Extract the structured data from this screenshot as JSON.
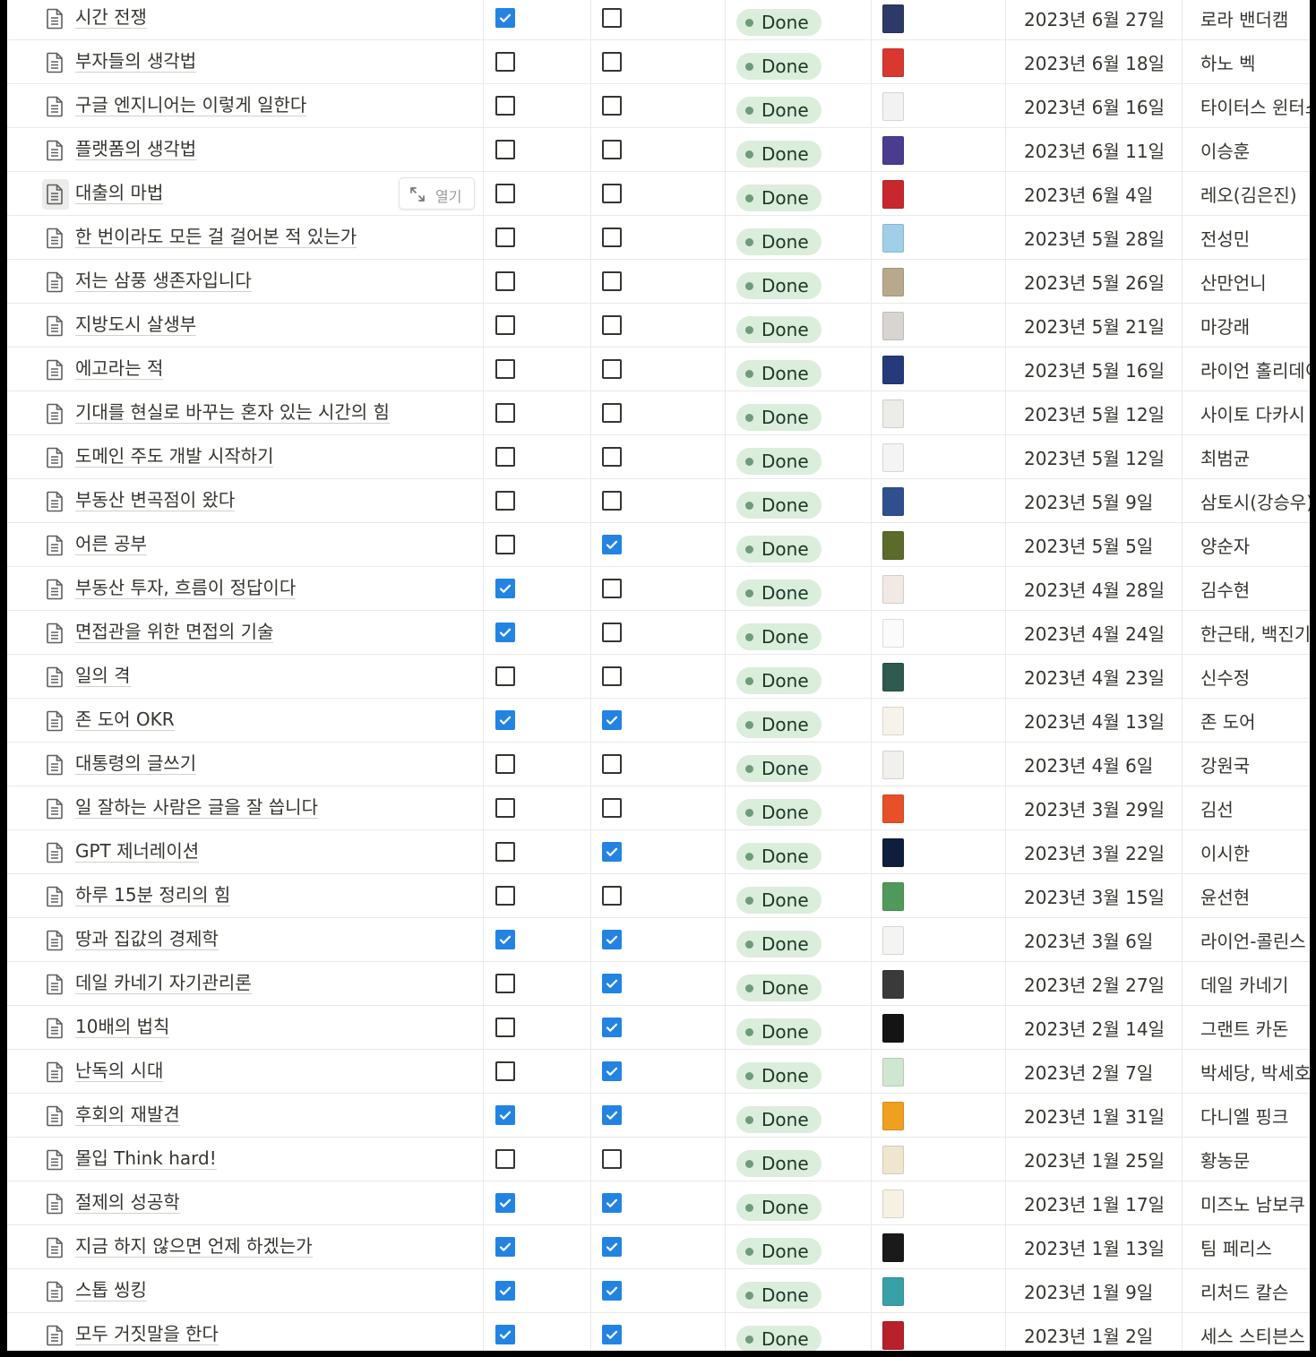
{
  "open_button_label": "열기",
  "rows": [
    {
      "title": "시간 전쟁",
      "check1": true,
      "check2": false,
      "status": "Done",
      "date": "2023년 6월 27일",
      "author": "로라 밴더캠",
      "cover_color": "#2b3a66"
    },
    {
      "title": "부자들의 생각법",
      "check1": false,
      "check2": false,
      "status": "Done",
      "date": "2023년 6월 18일",
      "author": "하노 벡",
      "cover_color": "#d9382e"
    },
    {
      "title": "구글 엔지니어는 이렇게 일한다",
      "check1": false,
      "check2": false,
      "status": "Done",
      "date": "2023년 6월 16일",
      "author": "타이터스 윈터스",
      "cover_color": "#f2f2f2"
    },
    {
      "title": "플랫폼의 생각법",
      "check1": false,
      "check2": false,
      "status": "Done",
      "date": "2023년 6월 11일",
      "author": "이승훈",
      "cover_color": "#4b3c8f"
    },
    {
      "title": "대출의 마법",
      "check1": false,
      "check2": false,
      "status": "Done",
      "date": "2023년 6월 4일",
      "author": "레오(김은진)",
      "cover_color": "#c8282d",
      "hover": true
    },
    {
      "title": "한 번이라도 모든 걸 걸어본 적 있는가",
      "check1": false,
      "check2": false,
      "status": "Done",
      "date": "2023년 5월 28일",
      "author": "전성민",
      "cover_color": "#9fd0e8"
    },
    {
      "title": "저는 삼풍 생존자입니다",
      "check1": false,
      "check2": false,
      "status": "Done",
      "date": "2023년 5월 26일",
      "author": "산만언니",
      "cover_color": "#b8a88c"
    },
    {
      "title": "지방도시 살생부",
      "check1": false,
      "check2": false,
      "status": "Done",
      "date": "2023년 5월 21일",
      "author": "마강래",
      "cover_color": "#d8d4cf"
    },
    {
      "title": "에고라는 적",
      "check1": false,
      "check2": false,
      "status": "Done",
      "date": "2023년 5월 16일",
      "author": "라이언 홀리데이",
      "cover_color": "#243a7a"
    },
    {
      "title": "기대를 현실로 바꾸는 혼자 있는 시간의 힘",
      "check1": false,
      "check2": false,
      "status": "Done",
      "date": "2023년 5월 12일",
      "author": "사이토 다카시",
      "cover_color": "#ecece8"
    },
    {
      "title": "도메인 주도 개발 시작하기",
      "check1": false,
      "check2": false,
      "status": "Done",
      "date": "2023년 5월 12일",
      "author": "최범균",
      "cover_color": "#f4f4f4"
    },
    {
      "title": "부동산 변곡점이 왔다",
      "check1": false,
      "check2": false,
      "status": "Done",
      "date": "2023년 5월 9일",
      "author": "삼토시(강승우)",
      "cover_color": "#2f4f8f"
    },
    {
      "title": "어른 공부",
      "check1": false,
      "check2": true,
      "status": "Done",
      "date": "2023년 5월 5일",
      "author": "양순자",
      "cover_color": "#5b6b2a"
    },
    {
      "title": "부동산 투자, 흐름이 정답이다",
      "check1": true,
      "check2": false,
      "status": "Done",
      "date": "2023년 4월 28일",
      "author": "김수현",
      "cover_color": "#f2e9e4"
    },
    {
      "title": "면접관을 위한 면접의 기술",
      "check1": true,
      "check2": false,
      "status": "Done",
      "date": "2023년 4월 24일",
      "author": "한근태, 백진기",
      "cover_color": "#fbfbfb"
    },
    {
      "title": "일의 격",
      "check1": false,
      "check2": false,
      "status": "Done",
      "date": "2023년 4월 23일",
      "author": "신수정",
      "cover_color": "#2e5a4f"
    },
    {
      "title": "존 도어 OKR",
      "check1": true,
      "check2": true,
      "status": "Done",
      "date": "2023년 4월 13일",
      "author": "존 도어",
      "cover_color": "#f7f3ea"
    },
    {
      "title": "대통령의 글쓰기",
      "check1": false,
      "check2": false,
      "status": "Done",
      "date": "2023년 4월 6일",
      "author": "강원국",
      "cover_color": "#f1f0ec"
    },
    {
      "title": "일 잘하는 사람은 글을 잘 씁니다",
      "check1": false,
      "check2": false,
      "status": "Done",
      "date": "2023년 3월 29일",
      "author": "김선",
      "cover_color": "#e8502a"
    },
    {
      "title": "GPT 제너레이션",
      "check1": false,
      "check2": true,
      "status": "Done",
      "date": "2023년 3월 22일",
      "author": "이시한",
      "cover_color": "#0e1f3d"
    },
    {
      "title": "하루 15분 정리의 힘",
      "check1": false,
      "check2": false,
      "status": "Done",
      "date": "2023년 3월 15일",
      "author": "윤선현",
      "cover_color": "#4f9a5b"
    },
    {
      "title": "땅과 집값의 경제학",
      "check1": true,
      "check2": true,
      "status": "Done",
      "date": "2023년 3월 6일",
      "author": "라이언-콜린스",
      "cover_color": "#f4f4f2"
    },
    {
      "title": "데일 카네기 자기관리론",
      "check1": false,
      "check2": true,
      "status": "Done",
      "date": "2023년 2월 27일",
      "author": "데일 카네기",
      "cover_color": "#3a3a3a"
    },
    {
      "title": "10배의 법칙",
      "check1": false,
      "check2": true,
      "status": "Done",
      "date": "2023년 2월 14일",
      "author": "그랜트 카돈",
      "cover_color": "#141414"
    },
    {
      "title": "난독의 시대",
      "check1": false,
      "check2": true,
      "status": "Done",
      "date": "2023년 2월 7일",
      "author": "박세당, 박세호",
      "cover_color": "#cfe7cf"
    },
    {
      "title": "후회의 재발견",
      "check1": true,
      "check2": true,
      "status": "Done",
      "date": "2023년 1월 31일",
      "author": "다니엘 핑크",
      "cover_color": "#f0a020"
    },
    {
      "title": "몰입 Think hard!",
      "check1": false,
      "check2": false,
      "status": "Done",
      "date": "2023년 1월 25일",
      "author": "황농문",
      "cover_color": "#efe6d0"
    },
    {
      "title": "절제의 성공학",
      "check1": true,
      "check2": true,
      "status": "Done",
      "date": "2023년 1월 17일",
      "author": "미즈노 남보쿠",
      "cover_color": "#f6f1e3"
    },
    {
      "title": "지금 하지 않으면 언제 하겠는가",
      "check1": true,
      "check2": true,
      "status": "Done",
      "date": "2023년 1월 13일",
      "author": "팀 페리스",
      "cover_color": "#1a1a1a"
    },
    {
      "title": "스톱 씽킹",
      "check1": true,
      "check2": true,
      "status": "Done",
      "date": "2023년 1월 9일",
      "author": "리처드 칼슨",
      "cover_color": "#3aa0a8"
    },
    {
      "title": "모두 거짓말을 한다",
      "check1": true,
      "check2": true,
      "status": "Done",
      "date": "2023년 1월 2일",
      "author": "세스 스티븐스",
      "cover_color": "#b8202a"
    }
  ]
}
